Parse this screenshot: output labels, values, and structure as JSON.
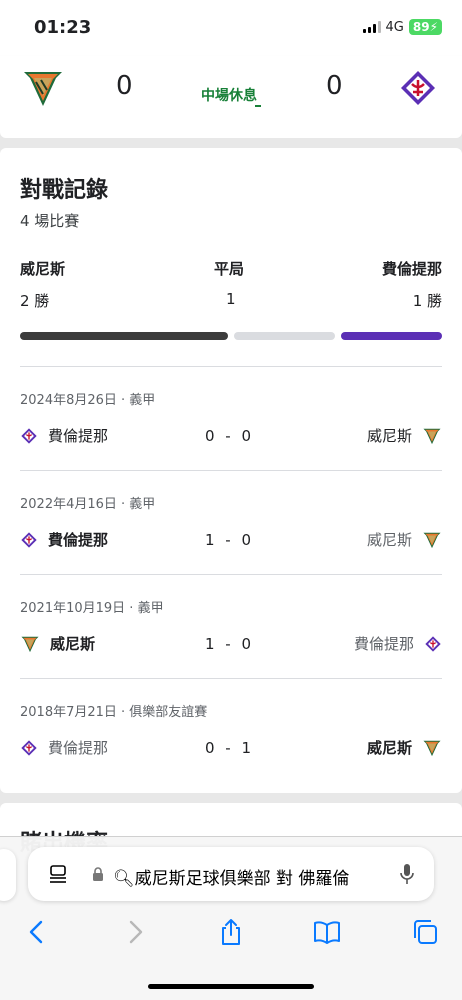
{
  "status_bar": {
    "time": "01:23",
    "network": "4G",
    "battery": "89"
  },
  "scoreboard": {
    "home_score": "0",
    "away_score": "0",
    "status": "中場休息"
  },
  "head_to_head": {
    "title": "對戰記錄",
    "subtitle": "4 場比賽",
    "home_team": "威尼斯",
    "draw_label": "平局",
    "away_team": "費倫提那",
    "home_wins": "2 勝",
    "draws": "1",
    "away_wins": "1 勝",
    "bar_colors": {
      "home": "#3c3c3c",
      "draw": "#dadce0",
      "away": "#5b2fb5"
    },
    "matches": [
      {
        "date": "2024年8月26日 · 義甲",
        "left_team": "費倫提那",
        "score": "0 - 0",
        "right_team": "威尼斯"
      },
      {
        "date": "2022年4月16日 · 義甲",
        "left_team": "費倫提那",
        "score": "1 - 0",
        "right_team": "威尼斯"
      },
      {
        "date": "2021年10月19日 · 義甲",
        "left_team": "威尼斯",
        "score": "1 - 0",
        "right_team": "費倫提那"
      },
      {
        "date": "2018年7月21日 · 俱樂部友誼賽",
        "left_team": "費倫提那",
        "score": "0 - 1",
        "right_team": "威尼斯"
      }
    ]
  },
  "next_section_title": "賭出機率",
  "browser": {
    "url": "威尼斯足球俱樂部 對 佛羅倫"
  }
}
